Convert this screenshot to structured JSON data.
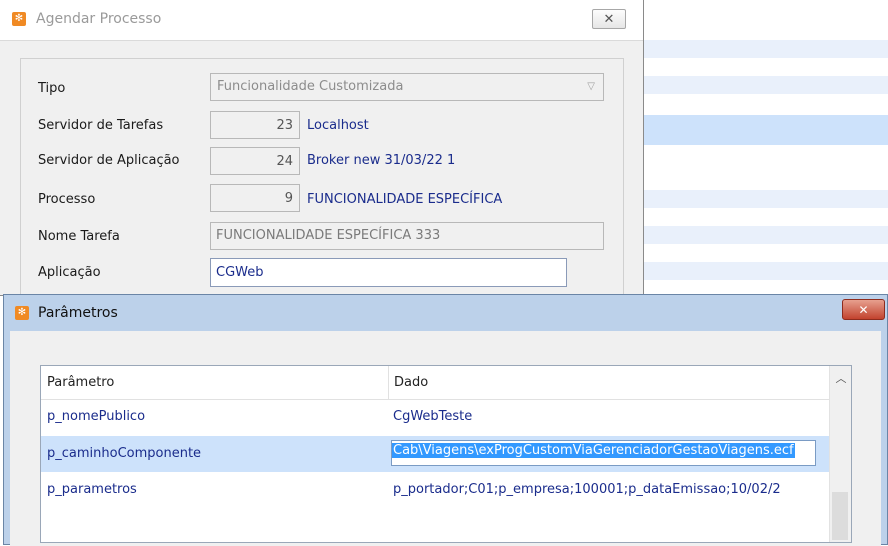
{
  "agendar": {
    "title": "Agendar Processo",
    "close_glyph": "✕",
    "tipo_label": "Tipo",
    "tipo_value": "Funcionalidade Customizada",
    "servidor_tarefas_label": "Servidor de Tarefas",
    "servidor_tarefas_code": "23",
    "servidor_tarefas_desc": "Localhost",
    "servidor_aplicacao_label": "Servidor de Aplicação",
    "servidor_aplicacao_code": "24",
    "servidor_aplicacao_desc": "Broker new 31/03/22 1",
    "processo_label": "Processo",
    "processo_code": "9",
    "processo_desc": "FUNCIONALIDADE ESPECÍFICA",
    "nome_tarefa_label": "Nome Tarefa",
    "nome_tarefa_value": "FUNCIONALIDADE ESPECÍFICA 333",
    "aplicacao_label": "Aplicação",
    "aplicacao_value": "CGWeb"
  },
  "parametros": {
    "title": "Parâmetros",
    "close_glyph": "✕",
    "columns": [
      "Parâmetro",
      "Dado"
    ],
    "rows": [
      {
        "param": "p_nomePublico",
        "dado": "CgWebTeste"
      },
      {
        "param": "p_caminhoComponente",
        "dado": "Cab\\Viagens\\exProgCustomViaGerenciadorGestaoViagens.ecf"
      },
      {
        "param": "p_parametros",
        "dado": "p_portador;C01;p_empresa;100001;p_dataEmissao;10/02/2"
      }
    ]
  },
  "icons": {
    "app_icon": "app-logo-icon",
    "combo_arrow": "chevron-down-icon",
    "scroll_up": "scroll-up-arrow-icon"
  },
  "colors": {
    "selection": "#cde2fb",
    "text_highlight": "#3399ff",
    "link_text": "#1a2c8c",
    "close_red": "#c2432e"
  }
}
